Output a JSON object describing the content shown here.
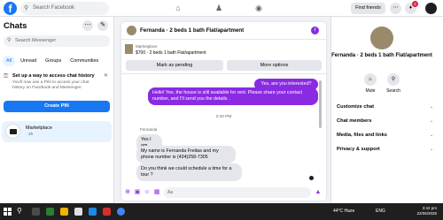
{
  "topbar": {
    "logo": "f",
    "search_placeholder": "Search Facebook",
    "find_friends": "Find friends",
    "notification_count": "2"
  },
  "sidebar": {
    "title": "Chats",
    "search_placeholder": "Search Messenger",
    "filters": [
      "All",
      "Unread",
      "Groups",
      "Communities"
    ],
    "pin_card": {
      "title": "Set up a way to access chat history",
      "desc": "You'll now use a PIN to access your chat history on Facebook and Messenger.",
      "button": "Create PIN"
    },
    "conversation": {
      "name": "Marketplace",
      "time": "· 3h"
    }
  },
  "chat": {
    "title": "Fernanda · 2 beds 1 bath Flat/apartment",
    "market_label": "Marketplace",
    "market_price": "$700 · 2 beds 1 bath Flat/apartment",
    "mark_pending": "Mark as pending",
    "more_options": "More options",
    "msg_out_1": "Yes, are you interested?",
    "msg_out_2": "Hello! Yes, the house is still available for rent. Please share your contact number, and I'll send you the details .",
    "timestamp": "2:20 PM",
    "sender": "Fernanda",
    "msg_in_1": "Yes I am",
    "msg_in_2": "My name is Fernanda Freitas and my phone number is (434)258-7305",
    "msg_in_3": "Do you think we could schedule a time for a tour ?",
    "composer_placeholder": "Aa"
  },
  "info": {
    "name": "Fernanda · 2 beds 1 bath Flat/apartment",
    "mute": "Mute",
    "search": "Search",
    "sections": [
      "Customize chat",
      "Chat members",
      "Media, files and links",
      "Privacy & support"
    ]
  },
  "taskbar": {
    "temp": "44°C  Haze",
    "clock_time": "3:42 pm",
    "clock_date": "22/05/2025",
    "lang": "ENG"
  },
  "colors": {
    "accent": "#8a2be2",
    "brand": "#1877f2"
  }
}
